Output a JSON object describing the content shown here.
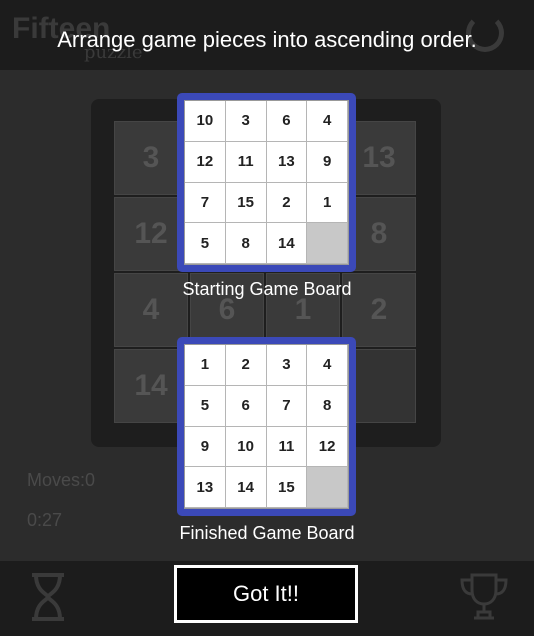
{
  "background_game": {
    "app_title": "Fifteen",
    "app_subtitle": "puzzle",
    "tiles": [
      "3",
      "",
      "",
      "13",
      "12",
      "",
      "",
      "8",
      "4",
      "6",
      "1",
      "2",
      "14",
      "",
      "",
      ""
    ],
    "moves_text": "Moves:0",
    "timer_text": "0:27"
  },
  "instructions": {
    "title": "Arrange game pieces into ascending order.",
    "starting_board": {
      "caption": "Starting Game Board",
      "tiles": [
        "10",
        "3",
        "6",
        "4",
        "12",
        "11",
        "13",
        "9",
        "7",
        "15",
        "2",
        "1",
        "5",
        "8",
        "14",
        ""
      ]
    },
    "finished_board": {
      "caption": "Finished Game Board",
      "tiles": [
        "1",
        "2",
        "3",
        "4",
        "5",
        "6",
        "7",
        "8",
        "9",
        "10",
        "11",
        "12",
        "13",
        "14",
        "15",
        ""
      ]
    },
    "confirm_label": "Got It!!"
  },
  "colors": {
    "board_frame": "#3b49b8",
    "empty_tile": "#c8c8c8",
    "button_bg": "#000000",
    "button_border": "#ffffff"
  },
  "icons": [
    "restart-icon",
    "hourglass-icon",
    "trophy-icon"
  ]
}
